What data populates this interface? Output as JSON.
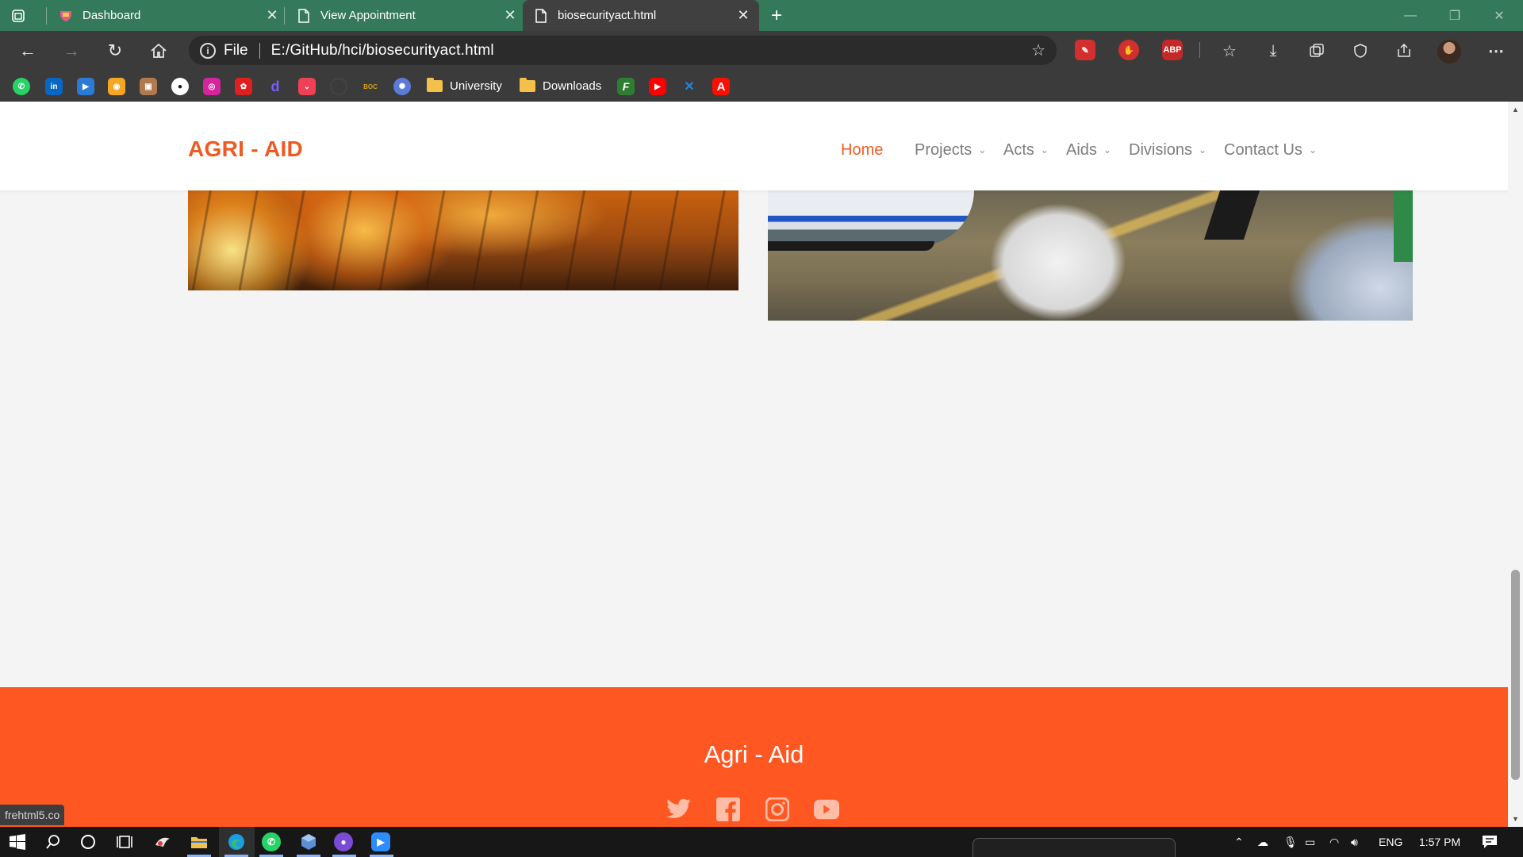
{
  "browser": {
    "tabs": [
      {
        "title": "Dashboard",
        "icon": "dashboard-favicon",
        "active": false
      },
      {
        "title": "View Appointment",
        "icon": "page-icon",
        "active": false
      },
      {
        "title": "biosecurityact.html",
        "icon": "page-icon",
        "active": true
      }
    ],
    "address": {
      "scheme": "File",
      "url": "E:/GitHub/hci/biosecurityact.html"
    },
    "extensions": [
      {
        "name": "pen-extension",
        "label": "",
        "color": "#d32f2f"
      },
      {
        "name": "hand-extension",
        "label": "",
        "color": "#d32f2f"
      },
      {
        "name": "adblock-extension",
        "label": "ABP",
        "color": "#c62828"
      }
    ],
    "bookmarks": [
      {
        "name": "whatsapp-bookmark",
        "label": "",
        "color": "#25d366"
      },
      {
        "name": "linkedin-bookmark",
        "label": "in",
        "color": "#0a66c2"
      },
      {
        "name": "media-bookmark",
        "label": "▶",
        "color": "#2b7bd6"
      },
      {
        "name": "film-bookmark",
        "label": "",
        "color": "#f5a623"
      },
      {
        "name": "image-bookmark",
        "label": "",
        "color": "#b07a50"
      },
      {
        "name": "github-bookmark",
        "label": "",
        "color": "#ffffff"
      },
      {
        "name": "instagram-bookmark",
        "label": "",
        "color": "#d6249f"
      },
      {
        "name": "huawei-bookmark",
        "label": "",
        "color": "#e02020"
      },
      {
        "name": "d-bookmark",
        "label": "d",
        "color": "#7b5cff"
      },
      {
        "name": "pocket-bookmark",
        "label": "",
        "color": "#ef4056"
      },
      {
        "name": "circle-bookmark",
        "label": "",
        "color": "#444444"
      },
      {
        "name": "boc-bookmark",
        "label": "BOC",
        "color": "#d4a017"
      },
      {
        "name": "emblem-bookmark",
        "label": "",
        "color": "#5c7bd9"
      }
    ],
    "bookmark_folders": [
      "University",
      "Downloads"
    ],
    "bookmarks_after": [
      {
        "name": "f-bookmark",
        "label": "F",
        "color": "#2e7d32"
      },
      {
        "name": "youtube-bookmark",
        "label": "▶",
        "color": "#ff0000"
      },
      {
        "name": "x-bookmark",
        "label": "✕",
        "color": "#1e88e5"
      },
      {
        "name": "adobe-bookmark",
        "label": "A",
        "color": "#fa0f00"
      }
    ]
  },
  "site": {
    "logo": "AGRI - AID",
    "nav": [
      {
        "label": "Home",
        "active": true,
        "dropdown": false
      },
      {
        "label": "Projects",
        "active": false,
        "dropdown": true
      },
      {
        "label": "Acts",
        "active": false,
        "dropdown": true
      },
      {
        "label": "Aids",
        "active": false,
        "dropdown": true
      },
      {
        "label": "Divisions",
        "active": false,
        "dropdown": true
      },
      {
        "label": "Contact Us",
        "active": false,
        "dropdown": true
      }
    ],
    "accent": "#f05a22",
    "footer": {
      "title": "Agri - Aid",
      "social": [
        "twitter-icon",
        "facebook-icon",
        "instagram-icon",
        "youtube-icon"
      ],
      "background": "#ff5722"
    }
  },
  "status_link": "frehtml5.co",
  "taskbar": {
    "lang": "ENG",
    "time": "1:57 PM"
  }
}
